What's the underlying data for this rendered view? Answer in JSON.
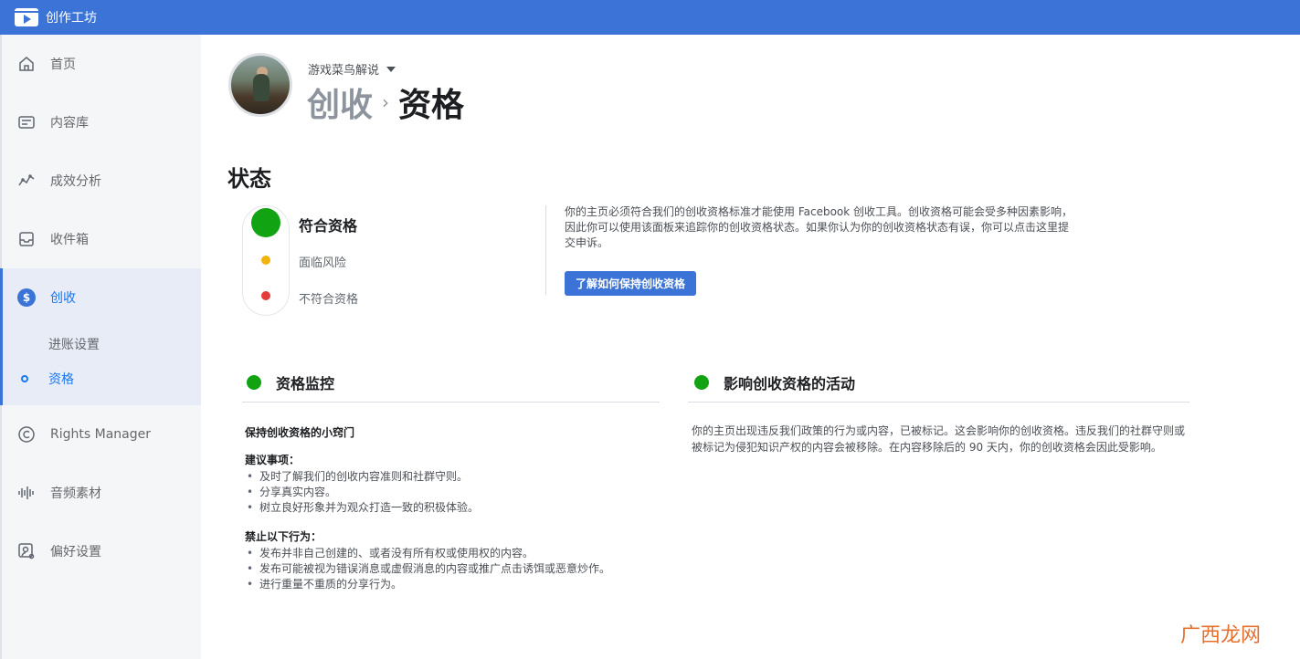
{
  "topbar": {
    "title": "创作工坊"
  },
  "sidebar": {
    "items": [
      {
        "label": "首页",
        "icon": "home-icon"
      },
      {
        "label": "内容库",
        "icon": "content-library-icon"
      },
      {
        "label": "成效分析",
        "icon": "analytics-icon"
      },
      {
        "label": "收件箱",
        "icon": "inbox-icon"
      }
    ],
    "monetize": {
      "label": "创收",
      "icon": "dollar-icon",
      "sub": [
        "进账设置",
        "资格"
      ]
    },
    "items_after": [
      {
        "label": "Rights Manager",
        "icon": "copyright-icon"
      },
      {
        "label": "音频素材",
        "icon": "audio-icon"
      },
      {
        "label": "偏好设置",
        "icon": "settings-user-icon"
      }
    ]
  },
  "header": {
    "page_name": "游戏菜鸟解说",
    "crumb_parent": "创收",
    "crumb_sep": "›",
    "crumb_current": "资格"
  },
  "status": {
    "heading": "状态",
    "levels": [
      "符合资格",
      "面临风险",
      "不符合资格"
    ],
    "description": "你的主页必须符合我们的创收资格标准才能使用 Facebook 创收工具。创收资格可能会受多种因素影响，因此你可以使用该面板来追踪你的创收资格状态。如果你认为你的创收资格状态有误，你可以点击这里提交申诉。",
    "button": "了解如何保持创收资格"
  },
  "monitor": {
    "title": "资格监控",
    "tips_title": "保持创收资格的小窍门",
    "recommended_title": "建议事项：",
    "recommended": [
      "及时了解我们的创收内容准则和社群守则。",
      "分享真实内容。",
      "树立良好形象并为观众打造一致的积极体验。"
    ],
    "prohibited_title": "禁止以下行为：",
    "prohibited": [
      "发布并非自己创建的、或者没有所有权或使用权的内容。",
      "发布可能被视为错误消息或虚假消息的内容或推广点击诱饵或恶意炒作。",
      "进行重量不重质的分享行为。"
    ]
  },
  "impact": {
    "title": "影响创收资格的活动",
    "text": "你的主页出现违反我们政策的行为或内容，已被标记。这会影响你的创收资格。违反我们的社群守则或被标记为侵犯知识产权的内容会被移除。在内容移除后的 90 天内，你的创收资格会因此受影响。"
  },
  "watermark": "广西龙网",
  "colors": {
    "brand": "#3b74d6",
    "eligible": "#11a311",
    "at_risk": "#f2b40c",
    "ineligible": "#e53a3a"
  }
}
